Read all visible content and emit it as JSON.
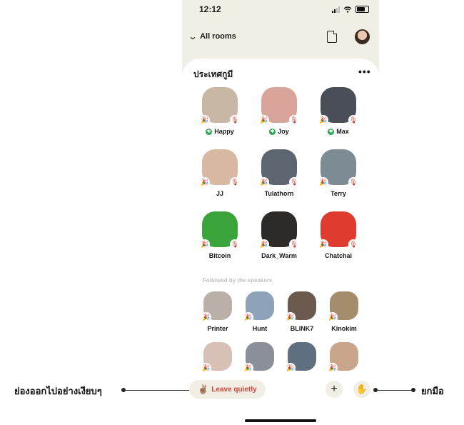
{
  "status": {
    "time": "12:12"
  },
  "header": {
    "back_label": "All rooms"
  },
  "room": {
    "title": "ประเทศกูมี",
    "more": "•••"
  },
  "speakers": [
    {
      "name": "Happy",
      "moderator": true,
      "color": "#c9b7a6"
    },
    {
      "name": "Joy",
      "moderator": true,
      "color": "#d9a49a"
    },
    {
      "name": "Max",
      "moderator": true,
      "color": "#4a4f57"
    },
    {
      "name": "JJ",
      "moderator": false,
      "color": "#d8b8a0"
    },
    {
      "name": "Tulathorn",
      "moderator": false,
      "color": "#5d6670"
    },
    {
      "name": "Terry",
      "moderator": false,
      "color": "#7d8c94"
    },
    {
      "name": "Bitcoin",
      "moderator": false,
      "color": "#3aa43a"
    },
    {
      "name": "Dark_Warm",
      "moderator": false,
      "color": "#2e2a28"
    },
    {
      "name": "Chatchai",
      "moderator": false,
      "color": "#e03b2f"
    }
  ],
  "followed_label": "Followed by the speakers",
  "listeners": [
    {
      "name": "Printer",
      "color": "#b9b0a8"
    },
    {
      "name": "Hunt",
      "color": "#8fa3b8"
    },
    {
      "name": "BLINK7",
      "color": "#6b5a4d"
    },
    {
      "name": "Kinokim",
      "color": "#a38d6c"
    },
    {
      "name": "",
      "color": "#d9c0b7"
    },
    {
      "name": "",
      "color": "#8b8f97"
    },
    {
      "name": "",
      "color": "#5f6f80"
    },
    {
      "name": "",
      "color": "#c9a58c"
    }
  ],
  "bottom": {
    "leave_emoji": "✌🏽",
    "leave_label": "Leave quietly",
    "plus": "+",
    "hand": "✋"
  },
  "callouts": {
    "left": "ย่องออกไปอย่างเงียบๆ",
    "right": "ยกมือ"
  },
  "colors": {
    "sheet_bg": "#f1efe5",
    "leave_text": "#d4403a",
    "moderator_badge": "#2aa84f"
  }
}
